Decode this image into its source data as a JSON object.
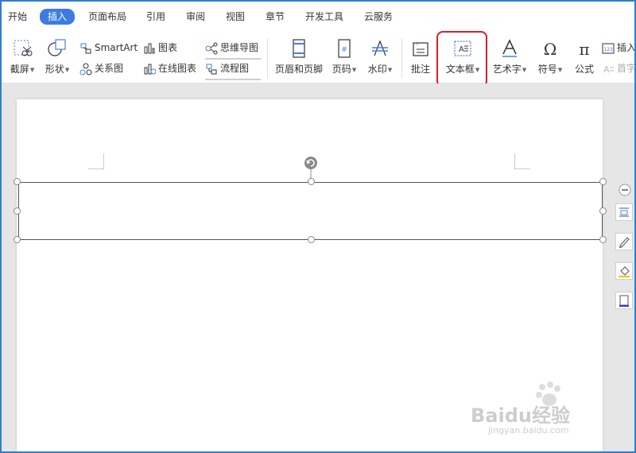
{
  "menu": {
    "tabs": [
      {
        "label": "开始",
        "active": false
      },
      {
        "label": "插入",
        "active": true
      },
      {
        "label": "页面布局",
        "active": false
      },
      {
        "label": "引用",
        "active": false
      },
      {
        "label": "审阅",
        "active": false
      },
      {
        "label": "视图",
        "active": false
      },
      {
        "label": "章节",
        "active": false
      },
      {
        "label": "开发工具",
        "active": false
      },
      {
        "label": "云服务",
        "active": false
      }
    ]
  },
  "ribbon": {
    "screenshot": "截屏",
    "shapes": "形状",
    "smartart": "SmartArt",
    "relation_chart": "关系图",
    "chart": "图表",
    "online_chart": "在线图表",
    "mind_map": "思维导图",
    "flowchart": "流程图",
    "header_footer": "页眉和页脚",
    "page_number": "页码",
    "watermark": "水印",
    "comment": "批注",
    "text_box": "文本框",
    "word_art": "艺术字",
    "symbol": "符号",
    "formula": "公式",
    "insert_number": "插入",
    "drop_cap": "首字"
  },
  "watermark": {
    "brand": "Baidu经验",
    "url": "jingyan.baidu.com"
  },
  "colors": {
    "accent": "#3c7ce0",
    "highlight": "#d6202a",
    "frame": "#2e7fd0"
  }
}
